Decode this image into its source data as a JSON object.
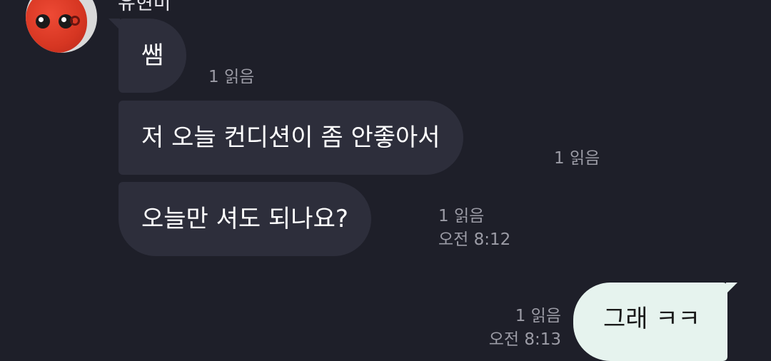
{
  "chat": {
    "sender": {
      "name": "유현미",
      "avatar_icon": "tomato-avatar-icon"
    },
    "messages": [
      {
        "direction": "incoming",
        "text": "쌤",
        "read": "1 읽음",
        "time": ""
      },
      {
        "direction": "incoming",
        "text": "저 오늘 컨디션이 좀 안좋아서",
        "read": "1 읽음",
        "time": ""
      },
      {
        "direction": "incoming",
        "text": "오늘만 셔도 되나요?",
        "read": "1 읽음",
        "time": "오전 8:12"
      },
      {
        "direction": "outgoing",
        "text": "그래 ㅋㅋ",
        "read": "1 읽음",
        "time": "오전 8:13"
      }
    ]
  },
  "colors": {
    "background": "#1e1f29",
    "incoming_bubble": "#2d2e3b",
    "outgoing_bubble": "#e6f3ee",
    "meta_text": "#9c9ca6"
  }
}
